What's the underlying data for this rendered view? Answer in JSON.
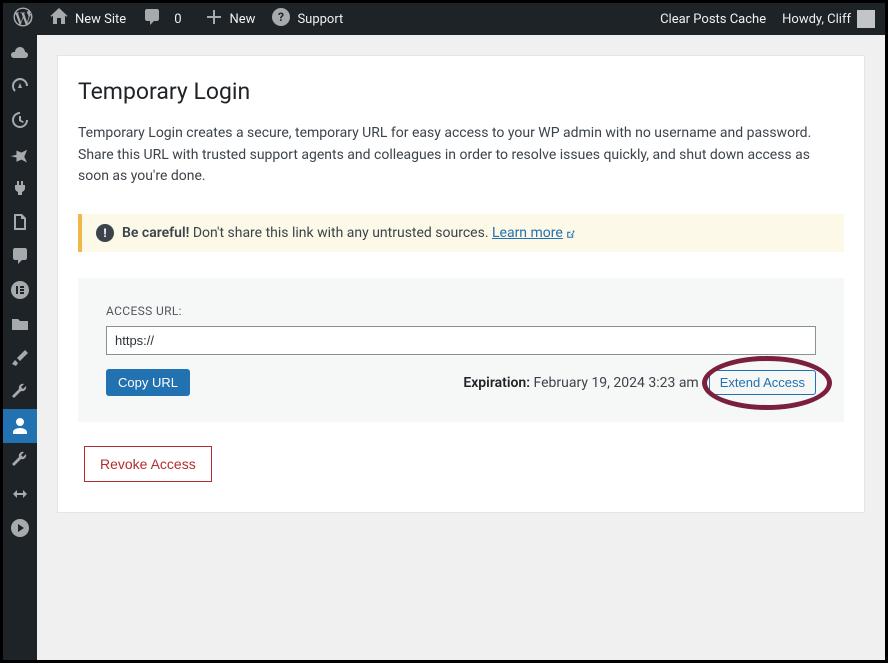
{
  "adminbar": {
    "site_name": "New Site",
    "comments_count": "0",
    "new_label": "New",
    "support_label": "Support",
    "clear_cache": "Clear Posts Cache",
    "howdy": "Howdy, Cliff"
  },
  "sidebar": {
    "items": [
      {
        "name": "cloud-icon"
      },
      {
        "name": "dashboard-icon"
      },
      {
        "name": "backup-icon"
      },
      {
        "name": "pin-icon"
      },
      {
        "name": "plugin-icon"
      },
      {
        "name": "pages-icon"
      },
      {
        "name": "comments-icon"
      },
      {
        "name": "elementor-icon"
      },
      {
        "name": "folder-icon"
      },
      {
        "name": "brush-icon"
      },
      {
        "name": "tools-icon"
      },
      {
        "name": "user-icon",
        "active": true
      },
      {
        "name": "settings-icon"
      },
      {
        "name": "migrate-icon"
      },
      {
        "name": "play-icon"
      }
    ]
  },
  "page": {
    "title": "Temporary Login",
    "description": "Temporary Login creates a secure, temporary URL for easy access to your WP admin with no username and password. Share this URL with trusted support agents and colleagues in order to resolve issues quickly, and shut down access as soon as you're done.",
    "notice_strong": "Be careful!",
    "notice_text": " Don't share this link with any untrusted sources. ",
    "notice_link": "Learn more",
    "access_url_label": "ACCESS URL:",
    "access_url_value": "https://",
    "copy_btn": "Copy URL",
    "expiration_label": "Expiration:",
    "expiration_value": " February 19, 2024 3:23 am ",
    "extend_btn": "Extend Access",
    "revoke_btn": "Revoke Access"
  }
}
